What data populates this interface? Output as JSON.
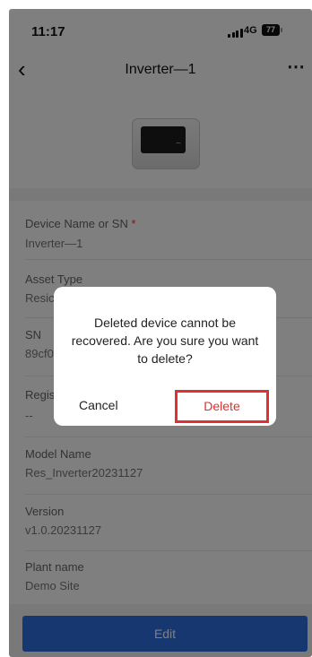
{
  "status_bar": {
    "time": "11:17",
    "network": "4G",
    "battery": "77"
  },
  "nav": {
    "title": "Inverter—1"
  },
  "fields": [
    {
      "label": "Device Name or SN",
      "required_mark": "*",
      "value": "Inverter—1"
    },
    {
      "label": "Asset Type",
      "value": "Resic"
    },
    {
      "label": "SN",
      "value": "89cf0"
    },
    {
      "label": "Regis",
      "value": "--"
    },
    {
      "label": "Model Name",
      "value": "Res_Inverter20231127"
    },
    {
      "label": "Version",
      "value": "v1.0.20231127"
    },
    {
      "label": "Plant name",
      "value": "Demo Site"
    }
  ],
  "edit_label": "Edit",
  "dialog": {
    "message": "Deleted device cannot be recovered. Are you sure you want to delete?",
    "cancel_label": "Cancel",
    "delete_label": "Delete"
  },
  "colors": {
    "primary": "#2f6fe0",
    "danger": "#e03030",
    "overlay": "rgba(0,0,0,0.5)"
  }
}
